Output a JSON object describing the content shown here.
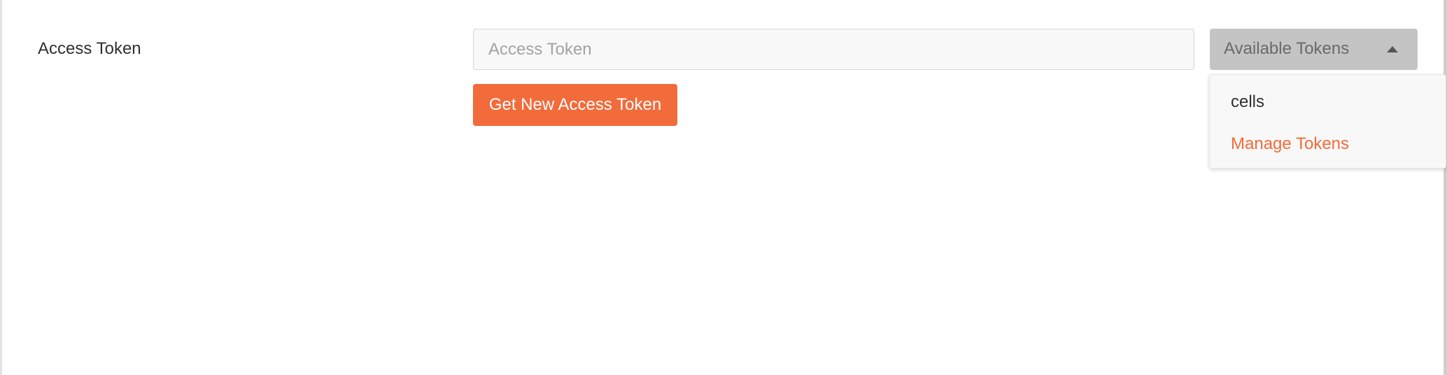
{
  "access_token": {
    "label": "Access Token",
    "input_value": "",
    "input_placeholder": "Access Token",
    "get_new_button_label": "Get New Access Token"
  },
  "tokens_dropdown": {
    "label": "Available Tokens",
    "icon": "caret-up-icon",
    "expanded": true,
    "items": [
      {
        "label": "cells"
      },
      {
        "label": "Manage Tokens"
      }
    ]
  },
  "colors": {
    "accent": "#f26b3a",
    "dropdown_bg": "#c4c4c4",
    "input_bg": "#f8f8f8",
    "text": "#303030"
  }
}
